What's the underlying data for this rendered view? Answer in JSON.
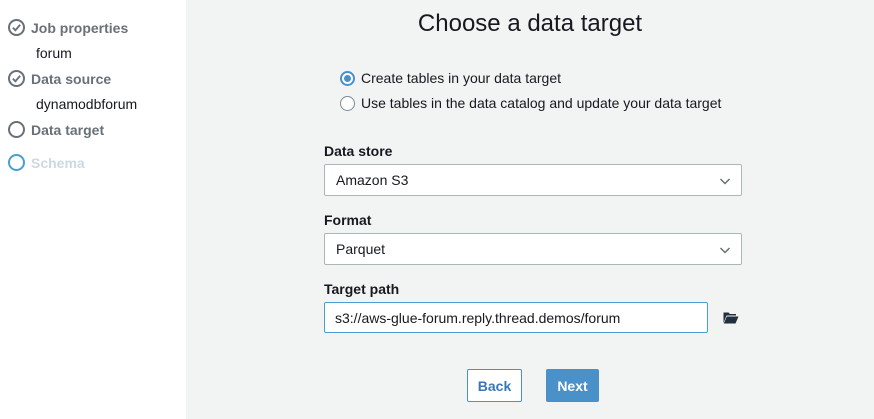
{
  "sidebar": {
    "steps": [
      {
        "label": "Job properties",
        "value": "forum",
        "status": "complete"
      },
      {
        "label": "Data source",
        "value": "dynamodbforum",
        "status": "complete"
      },
      {
        "label": "Data target",
        "value": "",
        "status": "current"
      },
      {
        "label": "Schema",
        "value": "",
        "status": "upcoming"
      }
    ]
  },
  "main": {
    "title": "Choose a data target",
    "radio_options": [
      {
        "label": "Create tables in your data target",
        "selected": true
      },
      {
        "label": "Use tables in the data catalog and update your data target",
        "selected": false
      }
    ],
    "data_store": {
      "label": "Data store",
      "value": "Amazon S3"
    },
    "format": {
      "label": "Format",
      "value": "Parquet"
    },
    "target_path": {
      "label": "Target path",
      "value": "s3://aws-glue-forum.reply.thread.demos/forum"
    },
    "back_label": "Back",
    "next_label": "Next"
  },
  "icons": {
    "check": "check-icon",
    "chevron": "chevron-down-icon",
    "folder": "folder-open-icon"
  },
  "colors": {
    "accent": "#4a90c9",
    "sidebar_text": "#687078",
    "disabled_text": "#cdd9e2",
    "background": "#f2f3f3"
  }
}
